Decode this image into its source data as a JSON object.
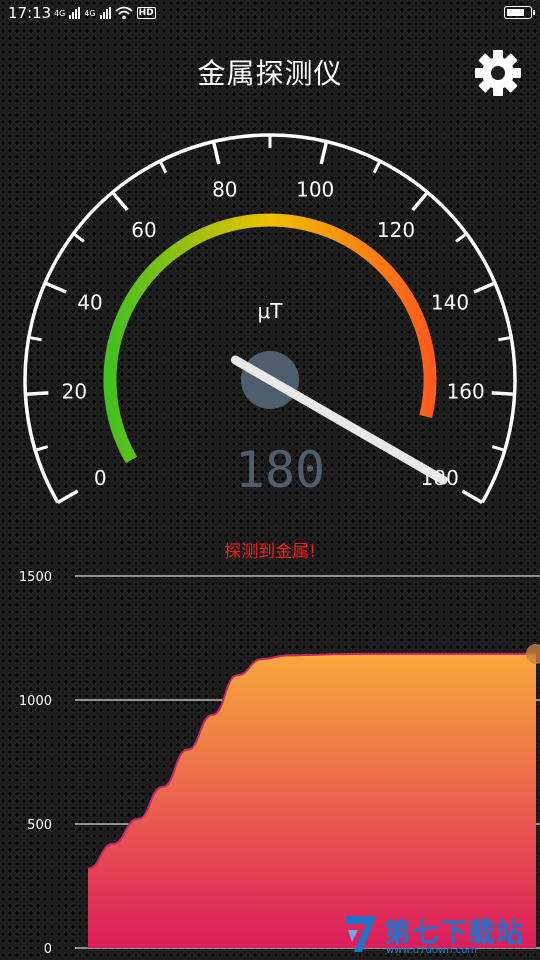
{
  "status_bar": {
    "time": "17:13",
    "signal_1": "4G",
    "signal_2": "4G",
    "hd_label": "HD"
  },
  "header": {
    "title": "金属探测仪",
    "settings_icon": "gear-icon"
  },
  "gauge": {
    "unit": "μT",
    "min": 0,
    "max": 180,
    "tick_labels": [
      "0",
      "20",
      "40",
      "60",
      "80",
      "100",
      "120",
      "140",
      "160",
      "180"
    ],
    "value": 180,
    "readout": "180",
    "colors": {
      "low": "#44c020",
      "mid": "#f0c000",
      "high": "#ff5a1f",
      "needle": "#ffffff",
      "hub": "#4f5e6c",
      "readout": "#4f5e6c"
    }
  },
  "status": {
    "message": "探测到金属!",
    "color": "#ff1a1a"
  },
  "chart_data": {
    "type": "area",
    "title": "",
    "xlabel": "",
    "ylabel": "",
    "ylim": [
      0,
      1500
    ],
    "y_ticks": [
      "0",
      "500",
      "1000",
      "1500"
    ],
    "grid": true,
    "x": [
      0,
      1,
      2,
      3,
      4,
      5,
      6,
      7,
      8,
      9,
      10,
      11,
      12,
      13,
      14,
      15,
      16,
      17,
      18
    ],
    "values": [
      320,
      420,
      520,
      650,
      800,
      940,
      1100,
      1165,
      1180,
      1182,
      1185,
      1186,
      1186,
      1186,
      1186,
      1186,
      1186,
      1186,
      1186
    ],
    "colors": {
      "top": "#f8a83c",
      "bottom": "#dd1c5c",
      "line": "#ffffff"
    }
  },
  "watermark": {
    "text": "第七下载站",
    "url": "www.d7down.com"
  }
}
